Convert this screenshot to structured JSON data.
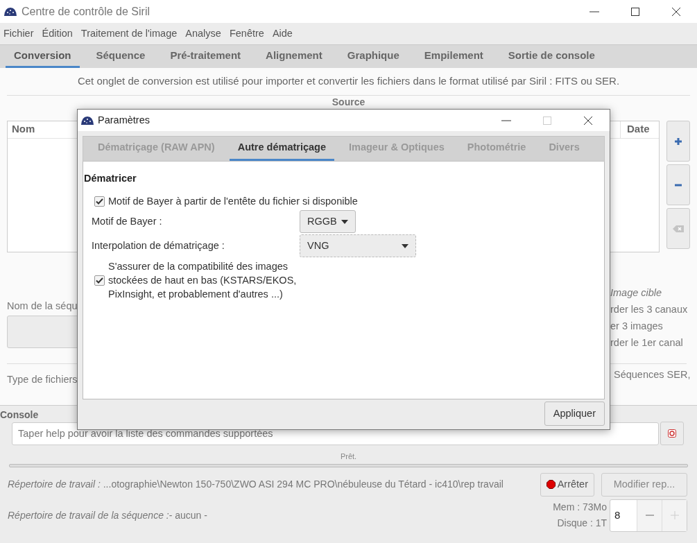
{
  "window": {
    "title": "Centre de contrôle de Siril"
  },
  "menu": [
    "Fichier",
    "Édition",
    "Traitement de l'image",
    "Analyse",
    "Fenêtre",
    "Aide"
  ],
  "tabs": [
    {
      "label": "Conversion",
      "selected": true
    },
    {
      "label": "Séquence",
      "selected": false
    },
    {
      "label": "Pré-traitement",
      "selected": false
    },
    {
      "label": "Alignement",
      "selected": false
    },
    {
      "label": "Graphique",
      "selected": false
    },
    {
      "label": "Empilement",
      "selected": false
    },
    {
      "label": "Sortie de console",
      "selected": false
    }
  ],
  "conversion": {
    "description": "Cet onglet de conversion est utilisé pour importer et convertir les fichiers dans le format utilisé par Siril : FITS ou SER.",
    "source_title": "Source",
    "table": {
      "columns": [
        "Nom",
        "Date"
      ]
    },
    "sequence_name_label": "Nom de la séqu",
    "file_type_label": "Type de fichiers",
    "right_texts": [
      {
        "kind": "heading",
        "text": "Image cible"
      },
      {
        "kind": "option",
        "text": "rder les 3 canaux"
      },
      {
        "kind": "option",
        "text": "er 3 images"
      },
      {
        "kind": "option",
        "text": "rder le 1er canal"
      },
      {
        "kind": "note",
        "text": "Séquences SER,"
      }
    ]
  },
  "console": {
    "title": "Console",
    "placeholder": "Taper help pour avoir la liste des commandes supportées",
    "status": "Prêt."
  },
  "footer": {
    "working_dir_label": "Répertoire de travail :",
    "working_dir": "...otographie\\Newton 150-750\\ZWO ASI 294 MC PRO\\nébuleuse du Tétard - ic410\\rep travail",
    "stop_button": "Arrêter",
    "change_button": "Modifier rep...",
    "seq_dir_label": "Répertoire de travail de la séquence :",
    "seq_dir": "- aucun -",
    "mem": "Mem : 73Mo",
    "disk": "Disque : 1T",
    "threads": "8"
  },
  "dialog": {
    "title": "Paramètres",
    "tabs": [
      {
        "label": "Dématriçage (RAW APN)",
        "selected": false
      },
      {
        "label": "Autre dématriçage",
        "selected": true
      },
      {
        "label": "Imageur & Optiques",
        "selected": false
      },
      {
        "label": "Photométrie",
        "selected": false
      },
      {
        "label": "Divers",
        "selected": false
      }
    ],
    "section": "Dématricer",
    "options": [
      {
        "kind": "checkbox",
        "label": "Motif de Bayer à partir de l'entête du fichier si disponible",
        "checked": true
      },
      {
        "kind": "menu_button",
        "label": "Motif de Bayer :",
        "value": "RGGB"
      },
      {
        "kind": "combo_box",
        "label": "Interpolation de dématriçage :",
        "value": "VNG"
      },
      {
        "kind": "checkbox",
        "label": "S'assurer de la compatibilité des images stockées de haut en bas (KSTARS/EKOS, PixInsight, et probablement d'autres ...)",
        "checked": true
      }
    ],
    "apply_button": "Appliquer"
  }
}
